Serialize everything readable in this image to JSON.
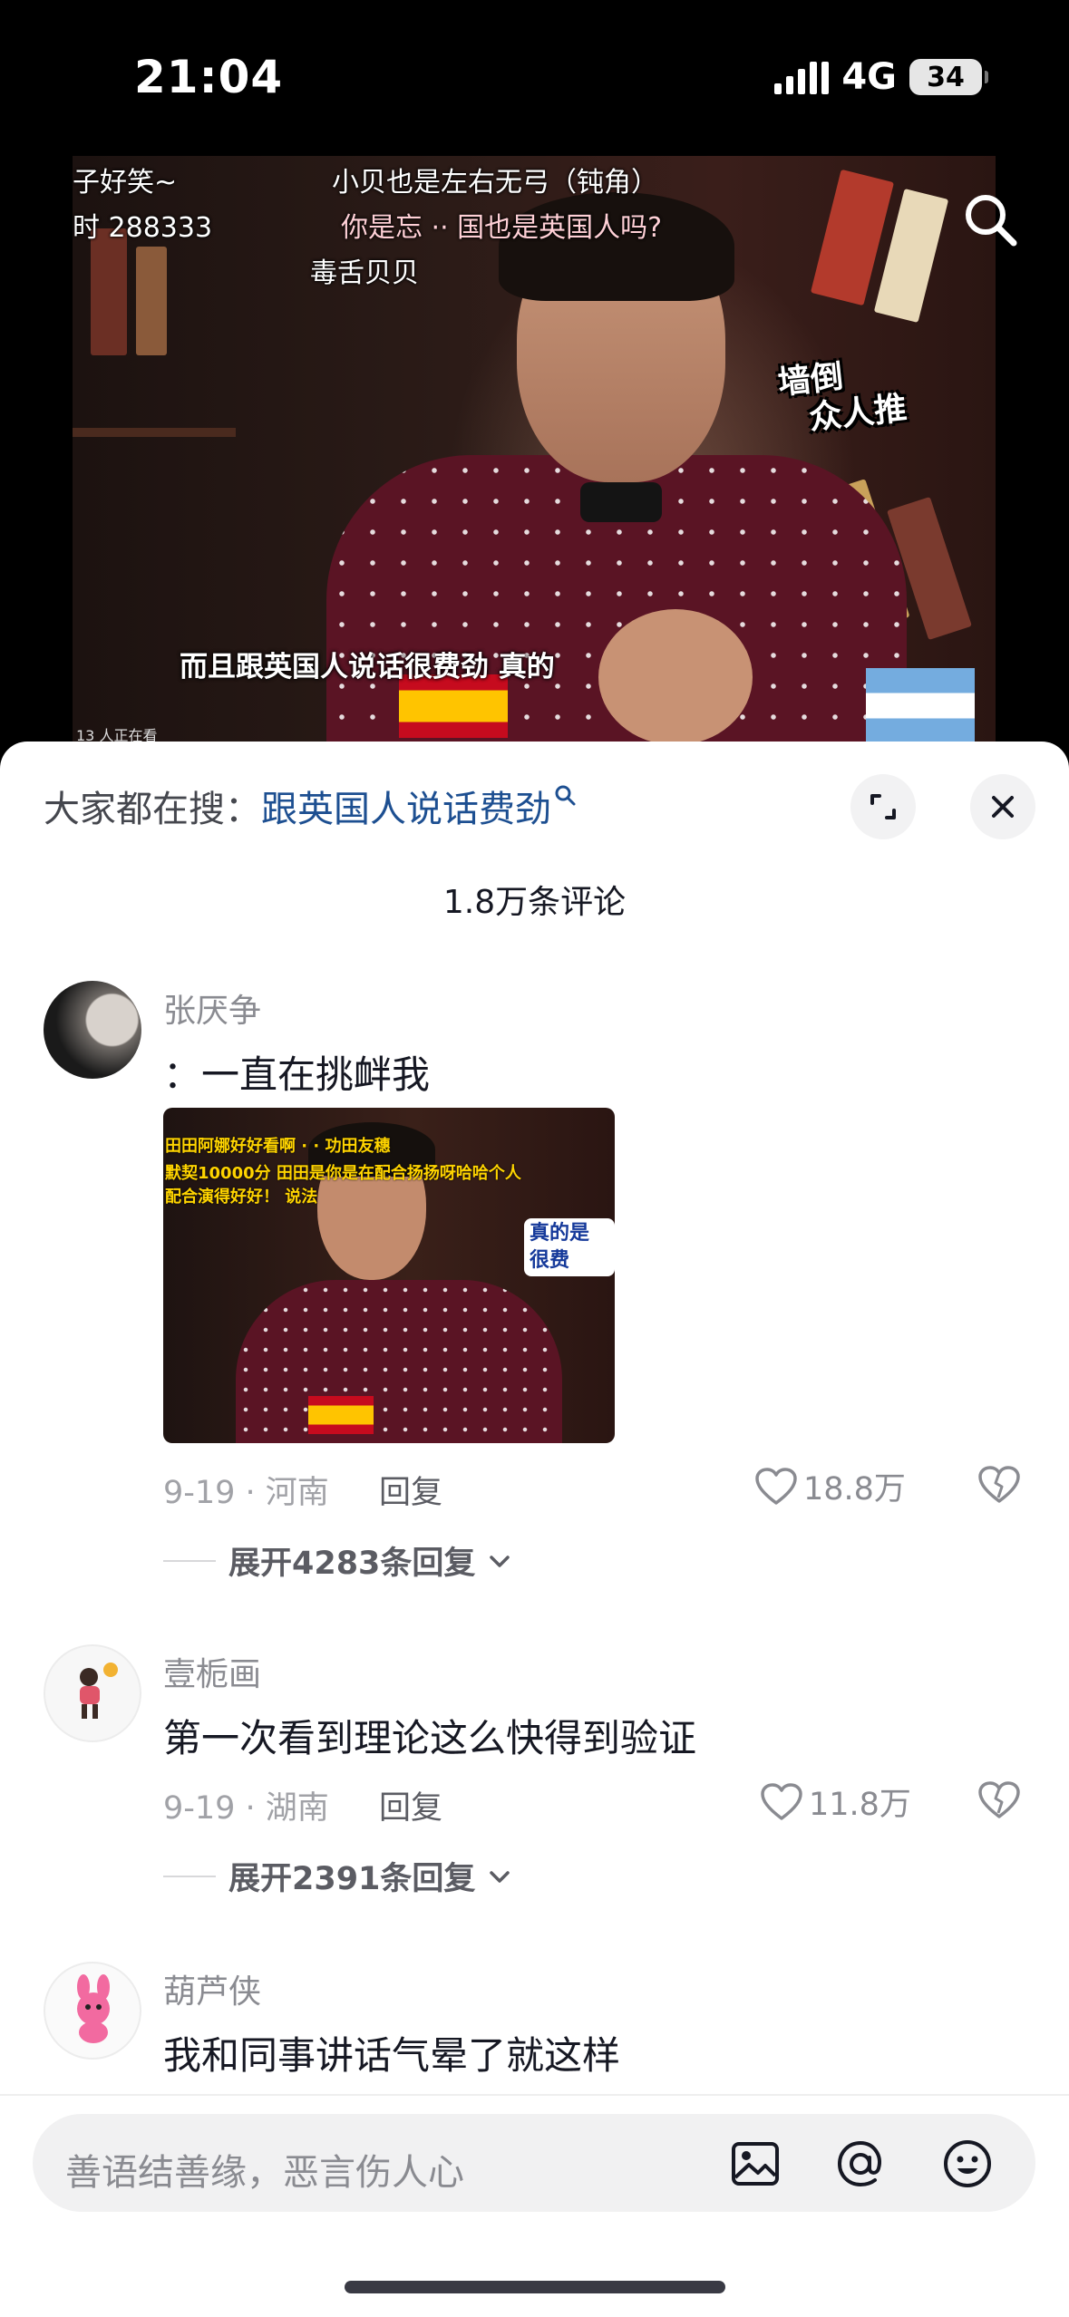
{
  "status_bar": {
    "time": "21:04",
    "network": "4G",
    "battery": "34"
  },
  "video": {
    "danmaku": [
      "子好笑~",
      "小贝也是左右无弓（钝角）",
      "时 288333",
      "你是忘 ·· 国也是英国人吗?",
      "毒舌贝贝"
    ],
    "sticker": [
      "墙倒",
      "众人推"
    ],
    "subtitle": "而且跟英国人说话很费劲 真的",
    "viewers": "13 人正在看"
  },
  "sheet": {
    "trending_prefix": "大家都在搜：",
    "trending_term": "跟英国人说话费劲",
    "comment_count": "1.8万条评论"
  },
  "comments": [
    {
      "username": "张厌争",
      "text": "：一直在挑衅我",
      "meta": "9-19 · 河南",
      "reply": "回复",
      "likes": "18.8万",
      "expand": "展开4283条回复",
      "image_text": [
        "田田阿娜好好看啊   ·   ·   功田友穗",
        "默契10000分 田田是你是在配合扬扬呀哈哈个人",
        "配合演得好好！   说法"
      ],
      "image_bubble": "真的是 很费"
    },
    {
      "username": "壹栀画",
      "text": "第一次看到理论这么快得到验证",
      "meta": "9-19 · 湖南",
      "reply": "回复",
      "likes": "11.8万",
      "expand": "展开2391条回复"
    },
    {
      "username": "葫芦侠",
      "text": "我和同事讲话气晕了就这样"
    }
  ],
  "input": {
    "placeholder": "善语结善缘，恶言伤人心"
  },
  "icons": {
    "search": "search-icon",
    "expand": "expand-icon",
    "close": "close-icon",
    "like": "heart-icon",
    "dislike": "broken-heart-icon",
    "image": "image-icon",
    "mention": "at-icon",
    "emoji": "emoji-icon"
  },
  "colors": {
    "link": "#1d4f91",
    "text_primary": "#161823",
    "text_secondary": "#8a8b91",
    "shirt": "#5a1424"
  }
}
